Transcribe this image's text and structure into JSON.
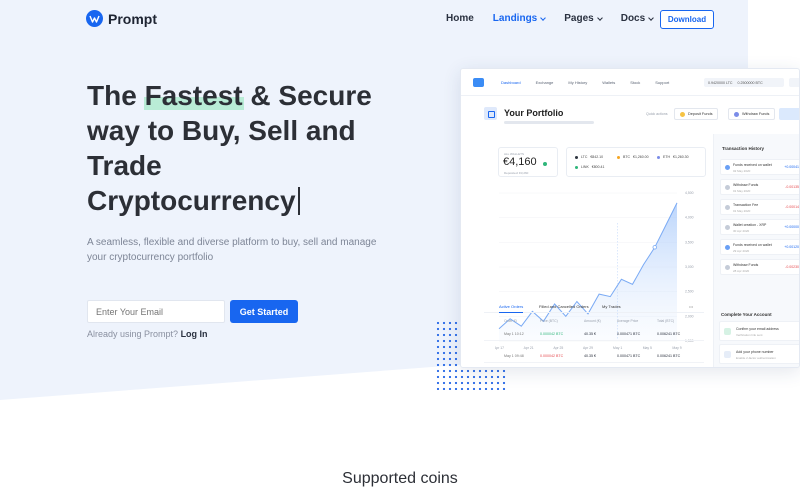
{
  "brand": {
    "name": "Prompt",
    "primary_color": "#1866f0",
    "highlight_color": "#b9ecd6"
  },
  "nav": {
    "items": [
      {
        "label": "Home",
        "active": false,
        "dropdown": false
      },
      {
        "label": "Landings",
        "active": true,
        "dropdown": true
      },
      {
        "label": "Pages",
        "active": false,
        "dropdown": true
      },
      {
        "label": "Docs",
        "active": false,
        "dropdown": true
      }
    ],
    "download_label": "Download"
  },
  "hero": {
    "headline_prefix": "The ",
    "headline_highlight": "Fastest",
    "headline_rest_1": " & Secure",
    "headline_line2": "way to Buy, Sell and",
    "headline_line3": "Trade",
    "headline_line4": "Cryptocurrency",
    "subtitle": "A seamless, flexible and diverse platform to buy, sell and manage your cryptocurrency portfolio",
    "email_placeholder": "Enter Your Email",
    "cta_label": "Get Started",
    "login_prompt": "Already using Prompt?",
    "login_link": "Log In"
  },
  "dashboard": {
    "tabs": [
      "Dashboard",
      "Exchange",
      "My History",
      "Wallets",
      "Stock",
      "Support"
    ],
    "balance_1": "0.9420000 LTC",
    "balance_2": "0.2500000 BTC",
    "title": "Your Portfolio",
    "quick_actions": "Quick actions",
    "deposit": "Deposit Funds",
    "withdraw": "Withdraw Funds",
    "value_label": "ALL WALLETS",
    "value": "€4,160",
    "value_sub": "Deposited: €3,260",
    "coins": [
      {
        "name": "LTC",
        "value": "€842.10",
        "color": "#2f3540"
      },
      {
        "name": "BTC",
        "value": "€1,260.00",
        "color": "#f6a623"
      },
      {
        "name": "ETH",
        "value": "€1,260.30",
        "color": "#7b8ce8"
      },
      {
        "name": "LINK",
        "value": "€800.41",
        "color": "#2fb67a"
      }
    ],
    "chart_x_labels": [
      "Apr 17",
      "Apr 21",
      "Apr 25",
      "Apr 29",
      "May 1",
      "May 5",
      "May 9"
    ],
    "chart_y_labels": [
      "4,500",
      "4,000",
      "3,500",
      "3,000",
      "2,500",
      "2,000",
      "1,500"
    ],
    "chart_values": [
      1750,
      1950,
      1800,
      2100,
      1900,
      2250,
      2000,
      2300,
      2050,
      2450,
      2400,
      2750,
      2650,
      3050,
      3400,
      3850,
      4300
    ],
    "chart_highlight": "May 1",
    "order_tabs": [
      "Active Orders",
      "Filled and Cancelled Orders",
      "My Trades"
    ],
    "order_headers": [
      "Order ID",
      "Price (BTC)",
      "Amount (€)",
      "Average Price",
      "Total (BTC)"
    ],
    "orders": [
      {
        "id": "May 1 10:12",
        "price": "0.000042 BTC",
        "amount": "40.35 €",
        "avg": "0.000471 BTC",
        "total": "0.006241 BTC",
        "price_red": false
      },
      {
        "id": "May 1 09:48",
        "price": "0.000042 BTC",
        "amount": "40.35 €",
        "avg": "0.000471 BTC",
        "total": "0.006241 BTC",
        "price_red": true
      }
    ],
    "history_title": "Transaction History",
    "history": [
      {
        "title": "Funds received on wallet",
        "sub": "02 May 2020",
        "amount": "+0.00041",
        "positive": true
      },
      {
        "title": "Withdraw Funds",
        "sub": "01 May 2020",
        "amount": "-0.00135",
        "positive": false
      },
      {
        "title": "Transaction Fee",
        "sub": "01 May 2020",
        "amount": "-0.00014",
        "positive": false
      },
      {
        "title": "Wallet creation - XRP",
        "sub": "30 Apr 2020",
        "amount": "+0.00000",
        "positive": true
      },
      {
        "title": "Funds received on wallet",
        "sub": "29 Apr 2020",
        "amount": "+0.00120",
        "positive": true
      },
      {
        "title": "Withdraw Funds",
        "sub": "28 Apr 2020",
        "amount": "-0.00230",
        "positive": false
      }
    ],
    "account_title": "Complete Your Account",
    "account_steps": [
      {
        "title": "Confirm your email address",
        "sub": "Verification link sent"
      },
      {
        "title": "Add your phone number",
        "sub": "Enable 2-factor authentication"
      }
    ]
  },
  "section_title": "Supported coins"
}
